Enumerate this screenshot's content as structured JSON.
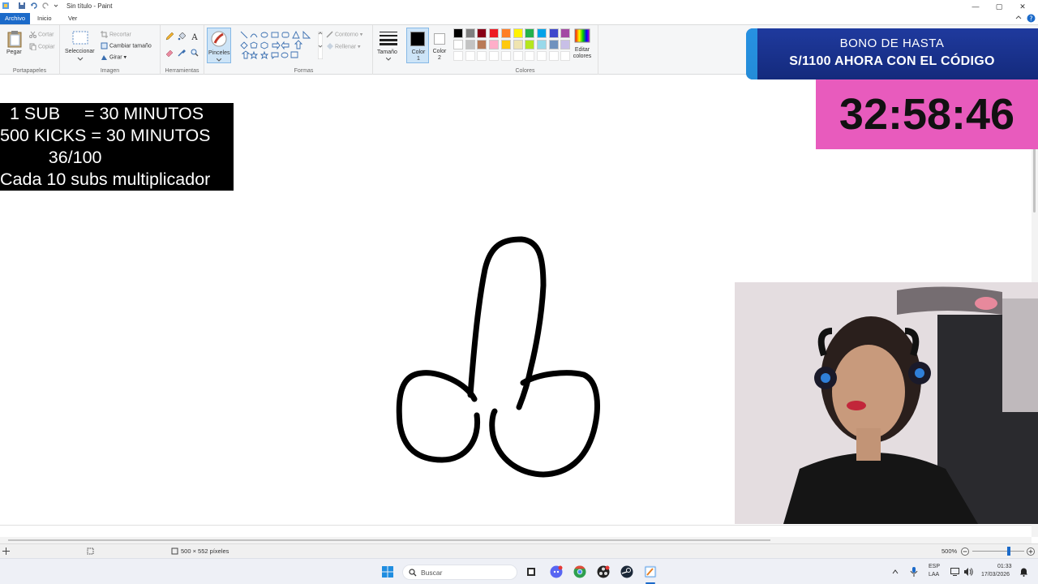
{
  "window": {
    "title": "Sin título - Paint",
    "controls": {
      "minimize": "—",
      "maximize": "▢",
      "close": "✕"
    }
  },
  "tabs": [
    "Archivo",
    "Inicio",
    "Ver"
  ],
  "ribbon": {
    "clipboard": {
      "label": "Portapapeles",
      "paste": "Pegar",
      "cut": "Cortar",
      "copy": "Copiar"
    },
    "image": {
      "label": "Imagen",
      "select": "Seleccionar",
      "crop": "Recortar",
      "resize": "Cambiar tamaño",
      "rotate": "Girar"
    },
    "tools": {
      "label": "Herramientas",
      "brushes": "Pinceles"
    },
    "shapes": {
      "label": "Formas",
      "outline": "Contorno",
      "fill": "Rellenar"
    },
    "size": "Tamaño",
    "color1": "Color 1",
    "color2": "Color 2",
    "colors": {
      "label": "Colores",
      "edit": "Editar colores"
    }
  },
  "palette_colors": [
    "#000000",
    "#7f7f7f",
    "#880015",
    "#ed1c24",
    "#ff7f27",
    "#fff200",
    "#22b14c",
    "#00a2e8",
    "#3f48cc",
    "#a349a4",
    "#ffffff",
    "#c3c3c3",
    "#b97a57",
    "#ffaec9",
    "#ffc90e",
    "#efe4b0",
    "#b5e61d",
    "#99d9ea",
    "#7092be",
    "#c8bfe7"
  ],
  "overlay": {
    "rules": [
      "  1 SUB     = 30 MINUTOS",
      "500 KICKS = 30 MINUTOS",
      "          36/100",
      "Cada 10 subs multiplicador"
    ],
    "banner_line1": "BONO DE HASTA",
    "banner_line2": "S/1100 AHORA CON EL CÓDIGO",
    "timer": "32:58:46"
  },
  "statusbar": {
    "dimensions": "500 × 552 píxeles",
    "zoom": "500%"
  },
  "taskbar": {
    "search": "Buscar",
    "lang": "ESP",
    "region": "LAA",
    "time": "01:33",
    "date": "17/03/2026"
  }
}
